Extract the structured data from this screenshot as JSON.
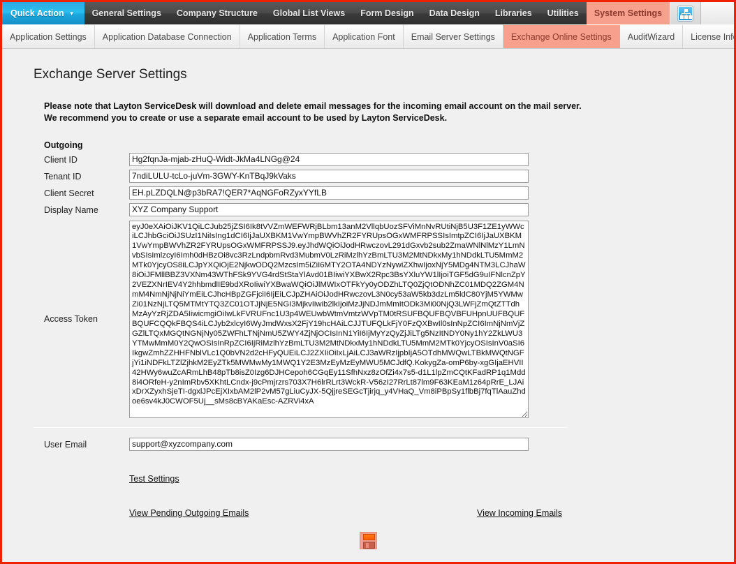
{
  "colors": {
    "frame_border": "#ee2200",
    "active_tab_bg": "#f8a08e",
    "active_tab_text": "#8c3a2c",
    "quick_action_blue": "#28c0f0",
    "page_bg": "#f0f0f0",
    "save_icon_orange": "#ff5c00"
  },
  "topnav": {
    "quick_action": {
      "label": "Quick Action",
      "caret": "▼"
    },
    "items": [
      {
        "label": "General Settings",
        "active": false
      },
      {
        "label": "Company Structure",
        "active": false
      },
      {
        "label": "Global List Views",
        "active": false
      },
      {
        "label": "Form Design",
        "active": false
      },
      {
        "label": "Data Design",
        "active": false
      },
      {
        "label": "Libraries",
        "active": false
      },
      {
        "label": "Utilities",
        "active": false
      },
      {
        "label": "System Settings",
        "active": true
      }
    ],
    "icon": "org-chart-icon"
  },
  "subtabs": [
    {
      "label": "Application Settings",
      "active": false
    },
    {
      "label": "Application Database Connection",
      "active": false
    },
    {
      "label": "Application Terms",
      "active": false
    },
    {
      "label": "Application Font",
      "active": false
    },
    {
      "label": "Email Server Settings",
      "active": false
    },
    {
      "label": "Exchange Online Settings",
      "active": true
    },
    {
      "label": "AuditWizard",
      "active": false
    },
    {
      "label": "License Information",
      "active": false
    }
  ],
  "page": {
    "title": "Exchange Server Settings",
    "notice_line1": "Please note that Layton ServiceDesk will download and delete email messages for the incoming email account on the mail server.",
    "notice_line2": "We recommend you to create or use a separate email account to be used by Layton ServiceDesk.",
    "outgoing_heading": "Outgoing"
  },
  "fields": {
    "client_id": {
      "label": "Client ID",
      "value": "Hg2fqnJa-mjab-zHuQ-Widt-JkMa4LNGg@24"
    },
    "tenant_id": {
      "label": "Tenant ID",
      "value": "7ndiLULU-tcLo-juVm-3GWY-KnTBqJ9kVaks"
    },
    "client_secret": {
      "label": "Client Secret",
      "value": "EH.pLZDQLN@p3bRA7!QER7*AqNGFoRZyxYYfLB"
    },
    "display_name": {
      "label": "Display Name",
      "value": "XYZ Company Support"
    },
    "access_token": {
      "label": "Access Token",
      "value": "eyJ0eXAiOiJKV1QiLCJub25jZSI6Ik8tVVZmWEFWRjBLbm13anM2VllqbUozSFViMnNvRUtiNjB5U3F1ZE1yWWciLCJhbGciOiJSUzI1NiIsIng1dCI6IjJaUXBKM1VwYmpBWVhZR2FYRUpsOGxWMFRPSSIsImtpZCI6IjJaUXBKM1VwYmpBWVhZR2FYRUpsOGxWMFRPSSJ9.eyJhdWQiOiJodHRwczovL291dGxvb2sub2ZmaWNlNlMzY1LmNvbSIsImlzcyI6Imh0dHBzOi8vc3RzLndpbmRvd3MubmV0LzRiMzlhYzBmLTU3M2MtNDkxMy1hNDdkLTU5MmM2MTk0YjcyOS8iLCJpYXQiOjE2NjkwODQ2MzcsIm5iZiI6MTY2OTA4NDYzNywiZXhwIjoxNjY5MDg4NTM3LCJhaW8iOiJFMllBBZ3VXNm43WThFSk9YVG4rdStStaYlAvd01BIiwiYXBwX2Rpc3BsYXluYW1lIjoiTGF5dG9uIFNlcnZpY2VEZXNrIEV4Y2hhbmdlIE9bdXRoIiwiYXBwaWQiOiJlMWIxOTFkYy0yODZhLTQ0ZjQtODNhZC01MDQ2ZGM4NmM4NmNjNjNiYmEiLCJhcHBpZGFjciI6IjEiLCJpZHAiOiJodHRwczovL3N0cy53aW5kb3dzLm5ldC80YjM5YWMwZi01NzNjLTQ5MTMtYTQ3ZC01OTJjNjE5NGI3MjkvIiwib2lkIjoiMzJjNDJmMmItODk3Mi00NjQ3LWFjZmQtZTTdhMzAyYzRjZDA5IiwicmgiOiIwLkFVRUFnc1U3p4WEUwbWtmVmtzWVpTM0tRSUFBQUFBQVBFUHpnUUFBQUFBQUFCQQkFBQS4iLCJyb2xlcyI6WyJmdWxsX2FjY19hcHAiLCJJTUFQLkFjY0FzQXBwIl0sInNpZCI6ImNjNmVjZGZlLTQxMGQtNGNjNy05ZWFhLTNjNmU5ZWY4ZjNjOCIsInN1YiI6IjMyYzQyZjJiLTg5NzItNDY0Ny1hY2ZkLWU3YTMwMmM0Y2QwOSIsInRpZCI6IjRiMzlhYzBmLTU3M2MtNDkxMy1hNDdkLTU5MmM2MTk0YjcyOSIsInV0aSI6IkgwZmhZZHHFNblVLc1Q0bVN2d2cHFyQUEiLCJ2ZXIiOiIxLjAiLCJ3aWRzIjpbIjA5OTdhMWQwLTBkMWQtNGFjYi1iNDFkLTZlZjhkM2EyZTk5MWMwMy1MWQ1Y2E3MzEyMzEyMWU5MCJdfQ.KokygZa-omP6by-xgGIjaEHVII42HWy6wuZcARmLhB48pTb8isZ0Izg6DJHCepoh6CGqEy11SfhNxz8zOfZi4x7s5-d1L1lpZmCQtKFadRP1q1Mdd8i4ORfeH-y2nImRbv5XKhtLCndx-j9cPmjrzrs703X7H6lrRLrt3WckR-V56zI27RrLt87lm9F63KEaM1z64pRrE_LJAixDrXZyxhSjeTI-dgxlJPcEjXIxbAM2lP2vM57gLiuCyJX-5QjjreSEGcTjirjq_y4VHaQ_Vm8iPBpSy1flbBj7fqTlAauZhdoe6sv4kJ0CWOF5Uj__sMs8cBYAKaEsc-AZRVi4xA"
    },
    "user_email": {
      "label": "User Email",
      "value": "support@xyzcompany.com"
    }
  },
  "links": {
    "test_settings": "Test Settings",
    "view_pending_outgoing": "View Pending Outgoing Emails",
    "view_incoming": "View Incoming Emails"
  },
  "actions": {
    "save": "save-icon"
  }
}
